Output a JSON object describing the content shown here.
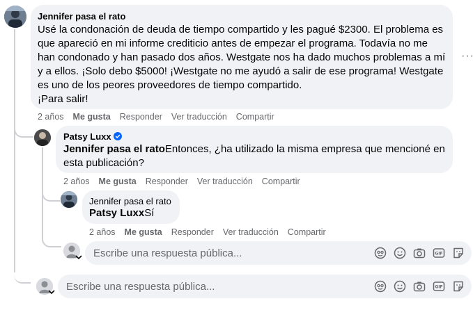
{
  "comment": {
    "author": "Jennifer pasa el rato",
    "text_lines": [
      "Usé la condonación de deuda de tiempo compartido y les pagué $2300. El problema es",
      "que apareció en mi informe crediticio antes de empezar el programa. Todavía no me",
      "han condonado y han pasado dos años. Westgate nos ha dado muchos problemas a mí",
      "y a ellos. ¡Solo debo $5000! ¡Westgate no me ayudó a salir de ese programa! Westgate",
      "es uno de los peores proveedores de tiempo compartido.",
      "¡Para salir!"
    ],
    "time": "2 años",
    "like": "Me gusta",
    "reply": "Responder",
    "translate": "Ver traducción",
    "share": "Compartir",
    "more": "···"
  },
  "reply1": {
    "author": "Patsy Luxx",
    "mention": "Jennifer pasa el rato",
    "text_line1": "Entonces, ¿ha utilizado la misma empresa que mencioné en",
    "text_line2": "esta publicación?",
    "time": "2 años",
    "like": "Me gusta",
    "reply": "Responder",
    "translate": "Ver traducción",
    "share": "Compartir"
  },
  "reply2": {
    "author": "Jennifer pasa el rato",
    "mention": "Patsy Luxx",
    "text": "Sí",
    "time": "2 años",
    "like": "Me gusta",
    "reply": "Responder",
    "translate": "Ver traducción",
    "share": "Compartir"
  },
  "reply_box_inner": {
    "placeholder": "Escribe una respuesta pública..."
  },
  "reply_box_outer": {
    "placeholder": "Escribe una respuesta pública..."
  },
  "colors": {
    "bubble": "#f0f2f5",
    "muted": "#65676b",
    "verified": "#0866ff",
    "line": "#ced0d4"
  }
}
